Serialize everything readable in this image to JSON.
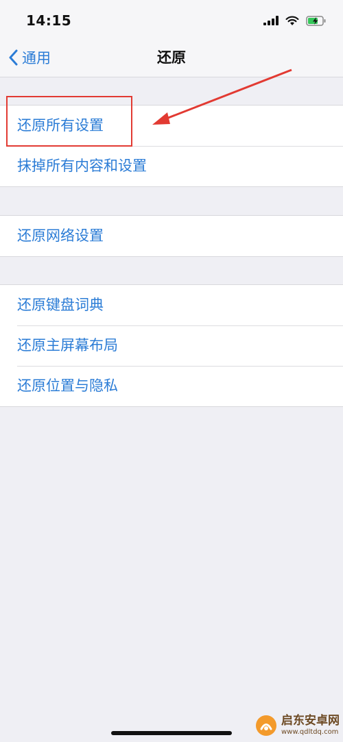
{
  "status_bar": {
    "time": "14:15"
  },
  "nav": {
    "back_label": "通用",
    "title": "还原"
  },
  "groups": [
    {
      "items": [
        {
          "label": "还原所有设置"
        },
        {
          "label": "抹掉所有内容和设置"
        }
      ]
    },
    {
      "items": [
        {
          "label": "还原网络设置"
        }
      ]
    },
    {
      "items": [
        {
          "label": "还原键盘词典"
        },
        {
          "label": "还原主屏幕布局"
        },
        {
          "label": "还原位置与隐私"
        }
      ]
    }
  ],
  "watermark": {
    "name": "启东安卓网",
    "url": "www.qdltdq.com"
  },
  "colors": {
    "accent": "#2b7cd6",
    "background": "#efeff4",
    "annotation": "#e23a32"
  },
  "icons": [
    "cellular-signal-icon",
    "wifi-icon",
    "battery-charging-icon",
    "chevron-left-icon"
  ]
}
